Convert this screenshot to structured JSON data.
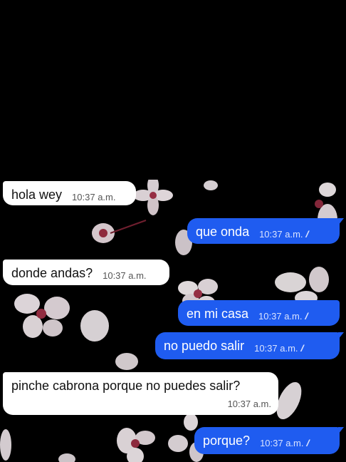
{
  "colors": {
    "incoming_bubble": "#ffffff",
    "outgoing_bubble": "#1f5cf0",
    "background": "#000000"
  },
  "messages": [
    {
      "direction": "in",
      "text": "hola wey",
      "time": "10:37 a.m."
    },
    {
      "direction": "out",
      "text": "que onda",
      "time": "10:37 a.m.",
      "status": "read-ticks-icon"
    },
    {
      "direction": "in",
      "text": "donde andas?",
      "time": "10:37 a.m."
    },
    {
      "direction": "out",
      "text": "en mi casa",
      "time": "10:37 a.m.",
      "status": "read-ticks-icon"
    },
    {
      "direction": "out",
      "text": "no puedo salir",
      "time": "10:37 a.m.",
      "status": "read-ticks-icon"
    },
    {
      "direction": "in",
      "text": "pinche cabrona porque no puedes salir?",
      "time": "10:37 a.m."
    },
    {
      "direction": "out",
      "text": "porque?",
      "time": "10:37 a.m.",
      "status": "read-ticks-icon"
    }
  ]
}
